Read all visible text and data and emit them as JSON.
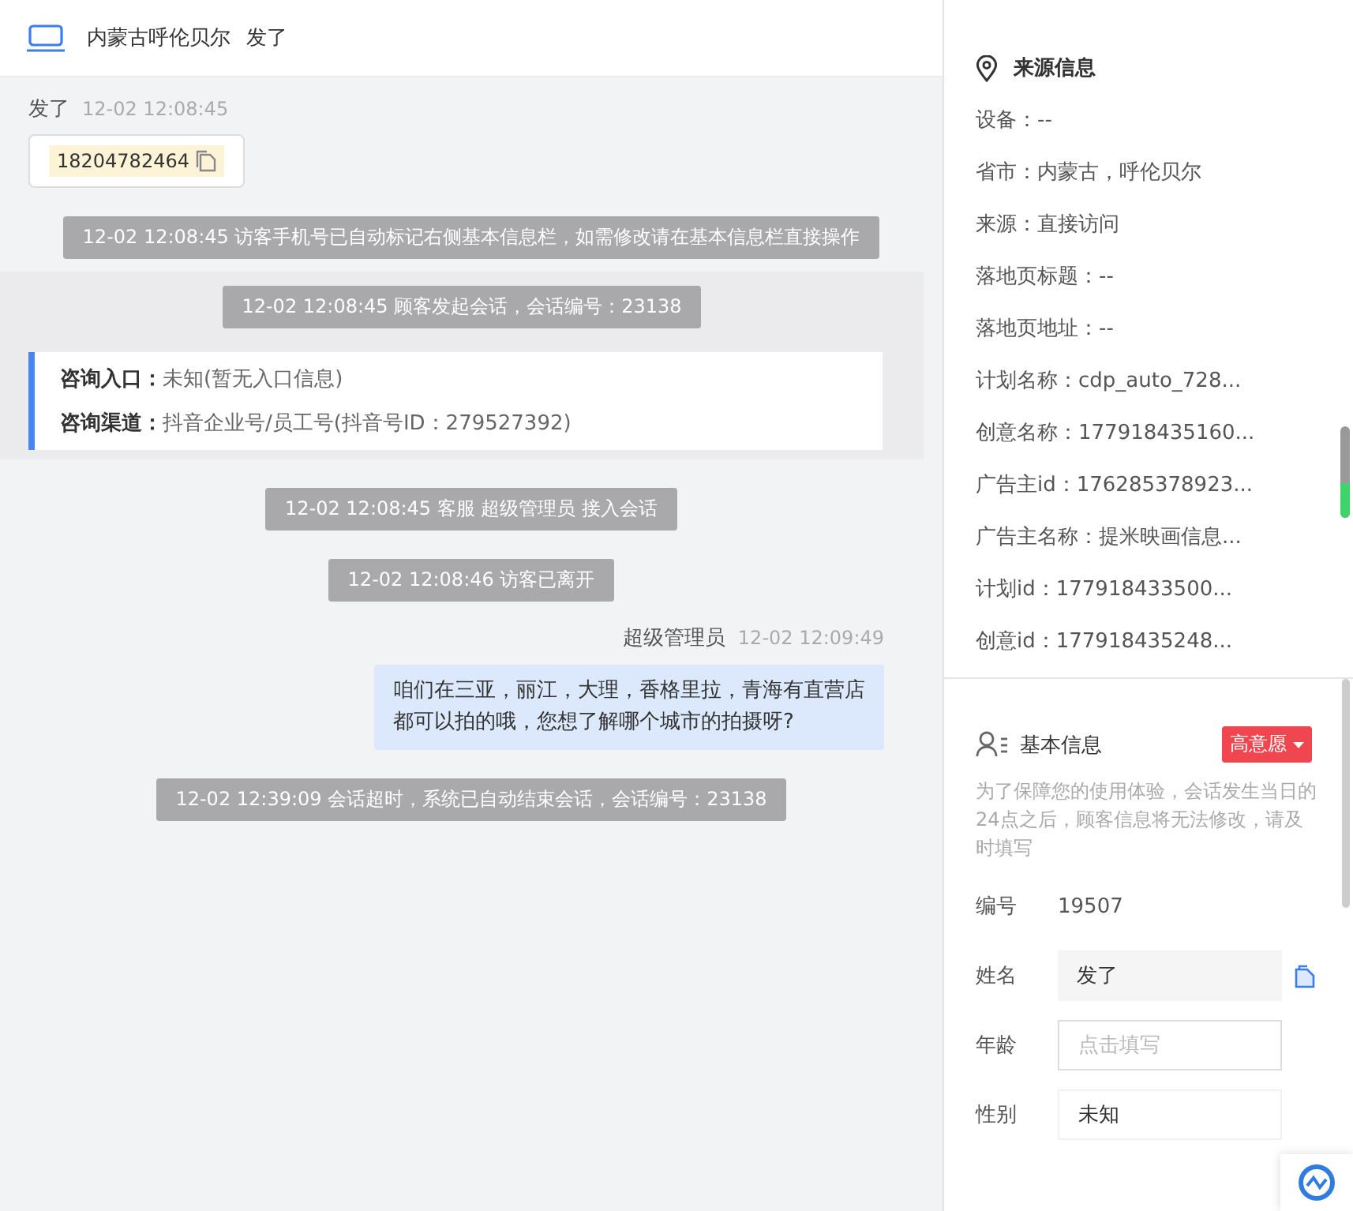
{
  "header": {
    "location": "内蒙古呼伦贝尔",
    "visitor": "发了"
  },
  "messages": [
    {
      "kind": "visitor",
      "sender": "发了",
      "time": "12-02 12:08:45",
      "phone": "18204782464"
    },
    {
      "kind": "system",
      "text": "12-02 12:08:45 访客手机号已自动标记右侧基本信息栏，如需修改请在基本信息栏直接操作"
    },
    {
      "kind": "session",
      "text": "12-02 12:08:45 顾客发起会话，会话编号：23138",
      "entries": [
        {
          "label": "咨询入口：",
          "value": "未知(暂无入口信息)"
        },
        {
          "label": "咨询渠道：",
          "value": "抖音企业号/员工号(抖音号ID：279527392)"
        }
      ]
    },
    {
      "kind": "system",
      "text": "12-02 12:08:45 客服 超级管理员 接入会话"
    },
    {
      "kind": "system",
      "text": "12-02 12:08:46 访客已离开"
    },
    {
      "kind": "agent",
      "sender": "超级管理员",
      "time": "12-02 12:09:49",
      "lines": [
        "咱们在三亚，丽江，大理，香格里拉，青海有直营店",
        "都可以拍的哦，您想了解哪个城市的拍摄呀?"
      ]
    },
    {
      "kind": "system",
      "text": "12-02 12:39:09 会话超时，系统已自动结束会话，会话编号：23138"
    }
  ],
  "source": {
    "title": "来源信息",
    "items": [
      "设备：--",
      "省市：内蒙古，呼伦贝尔",
      "来源：直接访问",
      "落地页标题：--",
      "落地页地址：--",
      "计划名称：cdp_auto_728...",
      "创意名称：177918435160...",
      "广告主id：176285378923...",
      "广告主名称：提米映画信息...",
      "计划id：177918433500...",
      "创意id：177918435248..."
    ]
  },
  "basic": {
    "title": "基本信息",
    "tag": "高意愿",
    "notice": "为了保障您的使用体验，会话发生当日的24点之后，顾客信息将无法修改，请及时填写",
    "fields": [
      {
        "kind": "text",
        "label": "编号",
        "value": "19507"
      },
      {
        "kind": "readonly",
        "label": "姓名",
        "value": "发了"
      },
      {
        "kind": "input",
        "label": "年龄",
        "placeholder": "点击填写"
      },
      {
        "kind": "select",
        "label": "性别",
        "value": "未知"
      }
    ]
  }
}
